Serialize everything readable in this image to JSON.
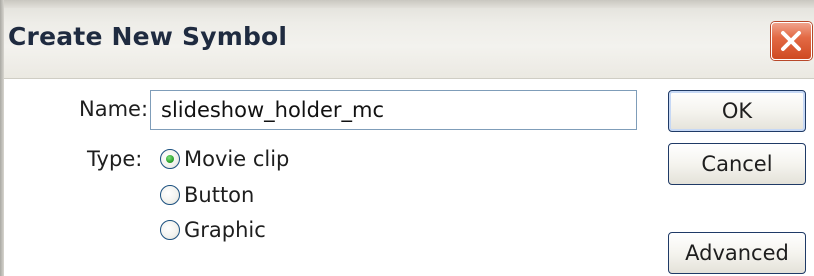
{
  "window": {
    "title": "Create New Symbol"
  },
  "form": {
    "name_label": "Name:",
    "name_value": "slideshow_holder_mc",
    "type_label": "Type:",
    "type_options": [
      {
        "label": "Movie clip",
        "selected": true
      },
      {
        "label": "Button",
        "selected": false
      },
      {
        "label": "Graphic",
        "selected": false
      }
    ]
  },
  "buttons": {
    "ok": "OK",
    "cancel": "Cancel",
    "advanced": "Advanced"
  },
  "icons": {
    "close": "close-icon"
  },
  "colors": {
    "title_text": "#1f2b40",
    "close_button": "#e36a45",
    "radio_selected": "#2fa52f",
    "button_border": "#1f3a66"
  }
}
